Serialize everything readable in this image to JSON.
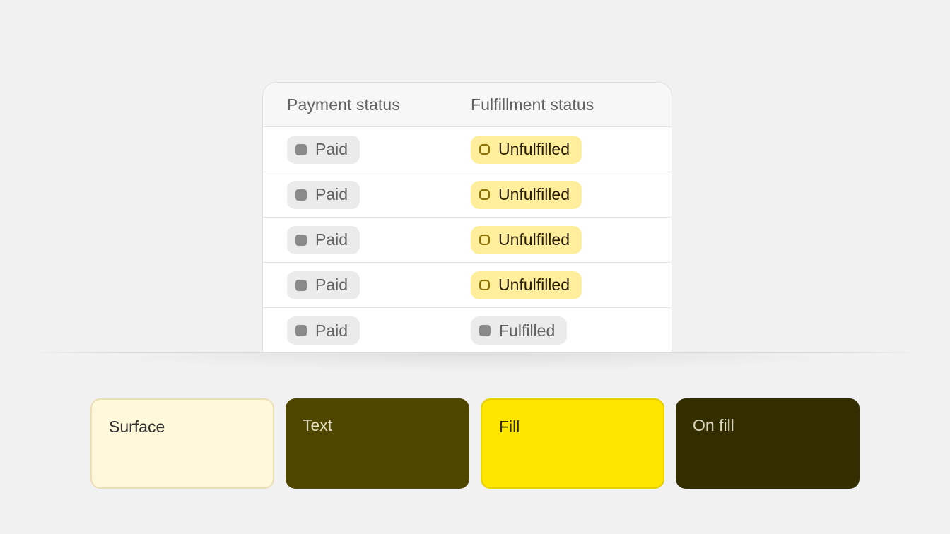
{
  "table": {
    "headers": {
      "payment": "Payment status",
      "fulfillment": "Fulfillment status"
    },
    "rows": [
      {
        "payment": "Paid",
        "payment_tone": "neutral",
        "fulfillment": "Unfulfilled",
        "fulfillment_tone": "warning"
      },
      {
        "payment": "Paid",
        "payment_tone": "neutral",
        "fulfillment": "Unfulfilled",
        "fulfillment_tone": "warning"
      },
      {
        "payment": "Paid",
        "payment_tone": "neutral",
        "fulfillment": "Unfulfilled",
        "fulfillment_tone": "warning"
      },
      {
        "payment": "Paid",
        "payment_tone": "neutral",
        "fulfillment": "Unfulfilled",
        "fulfillment_tone": "warning"
      },
      {
        "payment": "Paid",
        "payment_tone": "neutral",
        "fulfillment": "Fulfilled",
        "fulfillment_tone": "neutral"
      }
    ]
  },
  "swatches": [
    {
      "label": "Surface",
      "color": "#fff8db"
    },
    {
      "label": "Text",
      "color": "#4f4700"
    },
    {
      "label": "Fill",
      "color": "#ffe600"
    },
    {
      "label": "On fill",
      "color": "#332e00"
    }
  ],
  "colors": {
    "neutral_badge_bg": "#ebebeb",
    "neutral_badge_text": "#616161",
    "warning_badge_bg": "#ffef9d",
    "warning_badge_text": "#251a00"
  }
}
